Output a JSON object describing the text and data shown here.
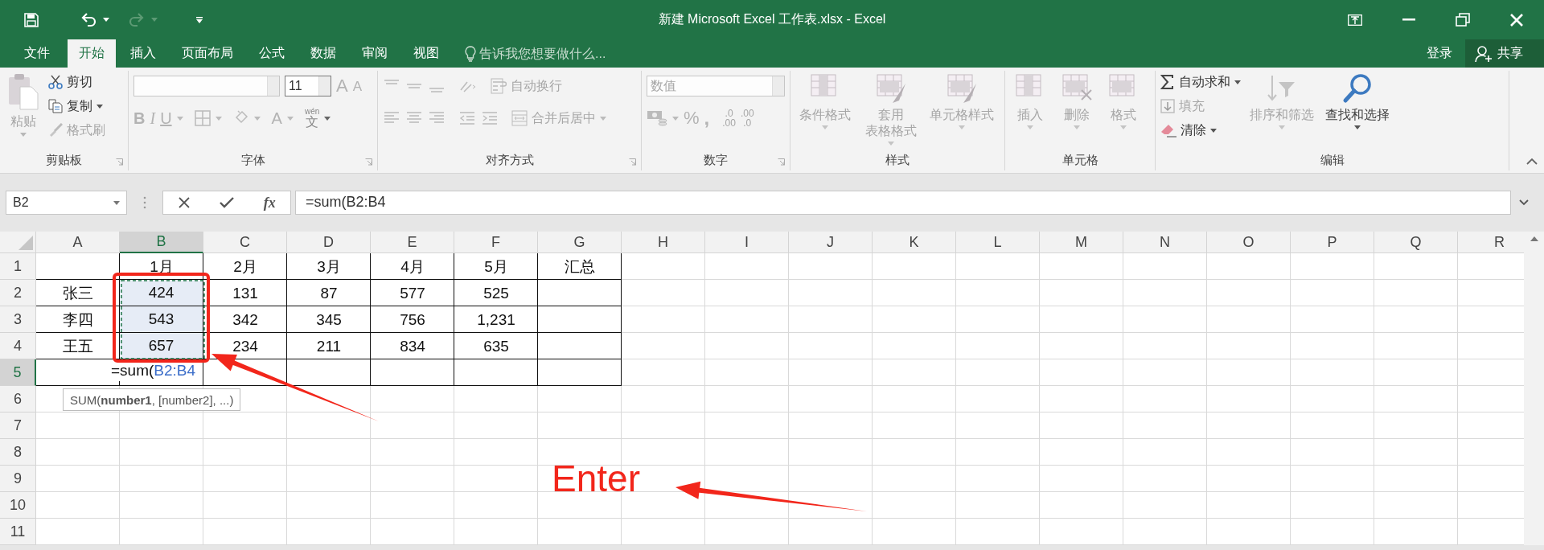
{
  "title_bar": {
    "title": "新建 Microsoft Excel 工作表.xlsx - Excel"
  },
  "tabs": [
    {
      "label": "文件",
      "selected": false
    },
    {
      "label": "开始",
      "selected": true
    },
    {
      "label": "插入",
      "selected": false
    },
    {
      "label": "页面布局",
      "selected": false
    },
    {
      "label": "公式",
      "selected": false
    },
    {
      "label": "数据",
      "selected": false
    },
    {
      "label": "审阅",
      "selected": false
    },
    {
      "label": "视图",
      "selected": false
    }
  ],
  "tell_me": {
    "placeholder": "告诉我您想要做什么..."
  },
  "account": {
    "sign_in": "登录",
    "share": "共享"
  },
  "ribbon": [
    {
      "kind": "clipboard",
      "label": "剪贴板",
      "paste": {
        "label": "粘贴",
        "disabled": true
      },
      "small": [
        {
          "label": "剪切",
          "disabled": false
        },
        {
          "label": "复制",
          "disabled": false
        },
        {
          "label": "格式刷",
          "disabled": true
        }
      ]
    },
    {
      "kind": "font",
      "label": "字体",
      "disabled": true,
      "font_size": "11",
      "grow": "A",
      "shrink": "A",
      "bold": "B",
      "italic": "I",
      "underline": "U",
      "font_color": "A",
      "phonetic": {
        "top": "wén",
        "main": "文"
      }
    },
    {
      "kind": "alignment",
      "label": "对齐方式",
      "disabled": true,
      "wrap": "自动换行",
      "merge": "合并后居中"
    },
    {
      "kind": "number",
      "label": "数字",
      "disabled": true,
      "format": "数值",
      "percent": "%",
      "comma": ",",
      "increase_decimal": [
        ".0",
        ".00"
      ],
      "decrease_decimal": [
        ".00",
        ".0"
      ]
    },
    {
      "kind": "styles",
      "label": "样式",
      "disabled": true,
      "items": [
        {
          "lines": [
            "条件格式"
          ]
        },
        {
          "lines": [
            "套用",
            "表格格式"
          ]
        },
        {
          "lines": [
            "单元格样式"
          ]
        }
      ]
    },
    {
      "kind": "cells",
      "label": "单元格",
      "disabled": true,
      "items": [
        {
          "label": "插入"
        },
        {
          "label": "删除"
        },
        {
          "label": "格式"
        }
      ]
    },
    {
      "kind": "editing",
      "label": "编辑",
      "small": [
        {
          "label": "自动求和",
          "disabled": false
        },
        {
          "label": "填充",
          "disabled": true
        },
        {
          "label": "清除",
          "disabled": false
        }
      ],
      "large": [
        {
          "label": "排序和筛选",
          "disabled": true
        },
        {
          "label": "查找和选择",
          "disabled": false
        }
      ]
    }
  ],
  "formula_bar": {
    "name_box": "B2",
    "function_button": "fx",
    "formula": "=sum(B2:B4"
  },
  "sheet": {
    "columns": [
      {
        "label": "A",
        "selected": false
      },
      {
        "label": "B",
        "selected": true
      },
      {
        "label": "C",
        "selected": false
      },
      {
        "label": "D",
        "selected": false
      },
      {
        "label": "E",
        "selected": false
      },
      {
        "label": "F",
        "selected": false
      },
      {
        "label": "G",
        "selected": false
      },
      {
        "label": "H",
        "selected": false
      },
      {
        "label": "I",
        "selected": false
      },
      {
        "label": "J",
        "selected": false
      },
      {
        "label": "K",
        "selected": false
      },
      {
        "label": "L",
        "selected": false
      },
      {
        "label": "M",
        "selected": false
      },
      {
        "label": "N",
        "selected": false
      },
      {
        "label": "O",
        "selected": false
      },
      {
        "label": "P",
        "selected": false
      },
      {
        "label": "Q",
        "selected": false
      },
      {
        "label": "R",
        "selected": false
      }
    ],
    "rows": [
      {
        "label": "1",
        "selected": false,
        "cells": [
          null,
          {
            "value": "1月",
            "in_range": false
          },
          {
            "value": "2月",
            "in_range": false
          },
          {
            "value": "3月",
            "in_range": false
          },
          {
            "value": "4月",
            "in_range": false
          },
          {
            "value": "5月",
            "in_range": false
          },
          {
            "value": "汇总",
            "in_range": false
          }
        ]
      },
      {
        "label": "2",
        "selected": false,
        "cells": [
          {
            "value": "张三",
            "in_range": false
          },
          {
            "value": "424",
            "in_range": true
          },
          {
            "value": "131",
            "in_range": false
          },
          {
            "value": "87",
            "in_range": false
          },
          {
            "value": "577",
            "in_range": false
          },
          {
            "value": "525",
            "in_range": false
          }
        ]
      },
      {
        "label": "3",
        "selected": false,
        "cells": [
          {
            "value": "李四",
            "in_range": false
          },
          {
            "value": "543",
            "in_range": true
          },
          {
            "value": "342",
            "in_range": false
          },
          {
            "value": "345",
            "in_range": false
          },
          {
            "value": "756",
            "in_range": false
          },
          {
            "value": "1,231",
            "in_range": false
          }
        ]
      },
      {
        "label": "4",
        "selected": false,
        "cells": [
          {
            "value": "王五",
            "in_range": false
          },
          {
            "value": "657",
            "in_range": true
          },
          {
            "value": "234",
            "in_range": false
          },
          {
            "value": "211",
            "in_range": false
          },
          {
            "value": "834",
            "in_range": false
          },
          {
            "value": "635",
            "in_range": false
          }
        ]
      },
      {
        "label": "5",
        "selected": true
      },
      {
        "label": "6",
        "selected": false
      },
      {
        "label": "7",
        "selected": false
      },
      {
        "label": "8",
        "selected": false
      },
      {
        "label": "9",
        "selected": false
      },
      {
        "label": "10",
        "selected": false
      },
      {
        "label": "11",
        "selected": false
      }
    ],
    "editing": {
      "prefix": "=sum(",
      "reference": "B2:B4",
      "tooltip": "SUM(**number1**, [number2], ...)"
    }
  },
  "annotations": [
    {
      "kind": "frame"
    },
    {
      "kind": "arrow"
    },
    {
      "kind": "arrow"
    },
    {
      "kind": "label",
      "text": "Enter"
    }
  ]
}
